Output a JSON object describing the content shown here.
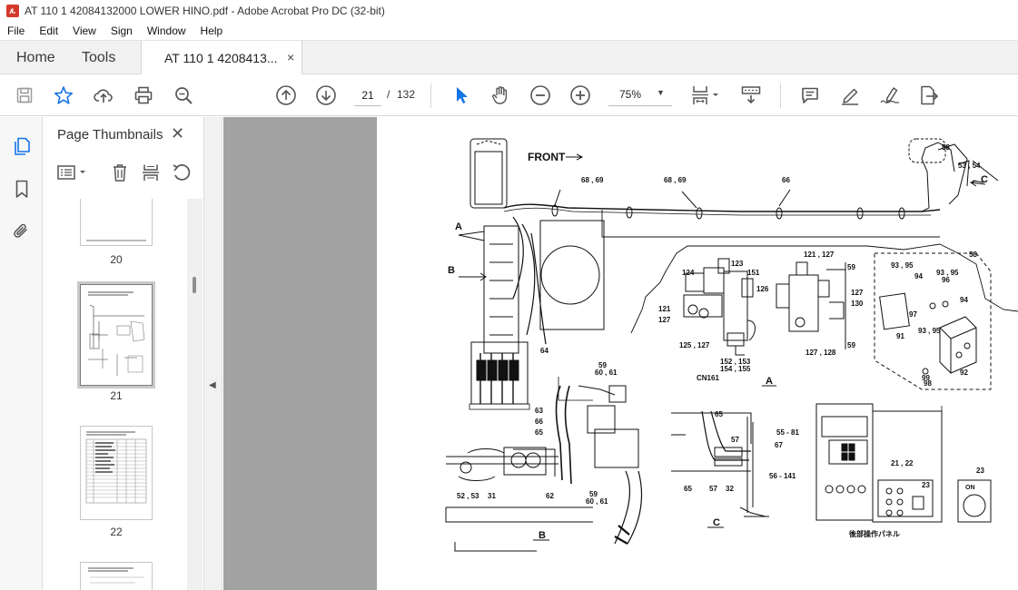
{
  "window": {
    "title": "AT 110 1 42084132000 LOWER HINO.pdf - Adobe Acrobat Pro DC (32-bit)",
    "icon": "acrobat-pdf-icon"
  },
  "menu": [
    "File",
    "Edit",
    "View",
    "Sign",
    "Window",
    "Help"
  ],
  "tabs": {
    "home": "Home",
    "tools": "Tools",
    "document": "AT 110 1 4208413...",
    "close_glyph": "×"
  },
  "toolbar": {
    "current_page": "21",
    "page_separator": "/",
    "page_total": "132",
    "zoom": "75%",
    "zoom_caret": "▼"
  },
  "thumbnails": {
    "title": "Page Thumbnails",
    "close_glyph": "✕",
    "pages": [
      {
        "label": "20"
      },
      {
        "label": "21",
        "selected": true
      },
      {
        "label": "22"
      }
    ]
  },
  "drawing": {
    "front_label": "FRONT",
    "callouts": {
      "a_main": "A",
      "b_main": "B",
      "c_main": "C",
      "c_68_69_left": "68 , 69",
      "c_68_69_right": "68 , 69",
      "c_66_top": "66",
      "c_58_top": "58",
      "c_53_54": "53 , 54",
      "c_64": "64",
      "c_123": "123",
      "c_124": "124",
      "c_151": "151",
      "c_121_left": "121",
      "c_127_left": "127",
      "c_125_127": "125 , 127",
      "c_152_153": "152 , 153",
      "c_154_155": "154 , 155",
      "c_cn161": "CN161",
      "c_121_127": "121 , 127",
      "c_126": "126",
      "c_59_a": "59",
      "c_127_right": "127",
      "c_130": "130",
      "c_127_128": "127 , 128",
      "c_59_b": "59",
      "c_detail_a": "A",
      "c_58_box": "58",
      "c_93_95_a": "93 , 95",
      "c_94_a": "94",
      "c_93_95_b": "93 , 95",
      "c_96": "96",
      "c_97": "97",
      "c_94_b": "94",
      "c_91": "91",
      "c_93_95_c": "93 , 95",
      "c_92": "92",
      "c_99": "99",
      "c_98": "98",
      "c_59_c": "59",
      "c_60_61_a": "60 , 61",
      "c_63": "63",
      "c_66_b": "66",
      "c_65_b": "65",
      "c_52_53": "52 , 53",
      "c_31": "31",
      "c_62": "62",
      "c_59_d": "59",
      "c_60_61_b": "60 , 61",
      "c_detail_b": "B",
      "c_65_c": "65",
      "c_57_a": "57",
      "c_55_81": "55  -  81",
      "c_67": "67",
      "c_65_d": "65",
      "c_57_b": "57",
      "c_32": "32",
      "c_56_141": "56  -  141",
      "c_detail_c": "C",
      "c_21_22": "21 , 22",
      "c_23_a": "23",
      "c_23_b": "23",
      "c_on": "ON",
      "c_panel_caption": "後部操作パネル"
    }
  }
}
